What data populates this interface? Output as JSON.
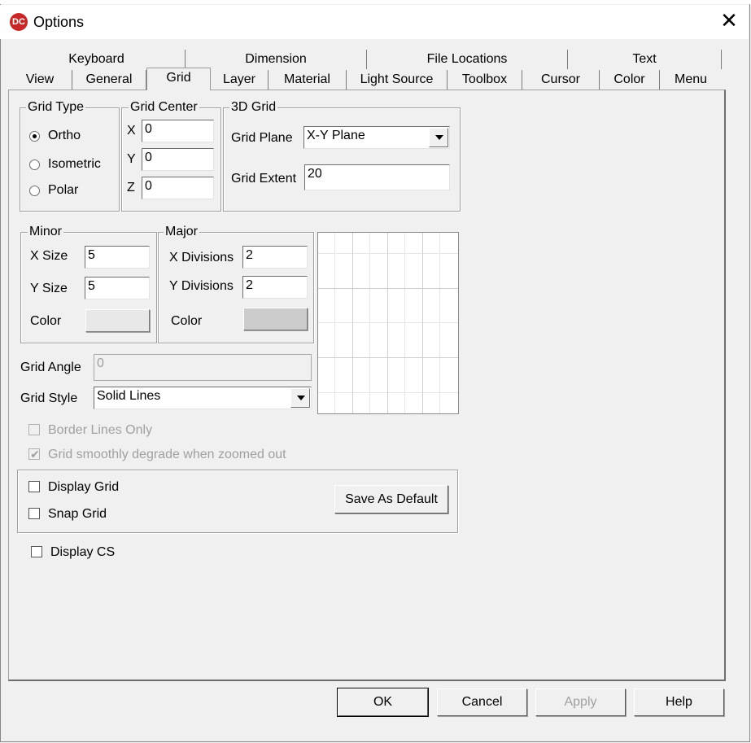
{
  "window": {
    "title": "Options",
    "app_icon": "DC"
  },
  "tabs_row1": [
    "Keyboard",
    "Dimension",
    "File Locations",
    "Text"
  ],
  "tabs_row2": [
    "View",
    "General",
    "Grid",
    "Layer",
    "Material",
    "Light Source",
    "Toolbox",
    "Cursor",
    "Color",
    "Menu"
  ],
  "selected_tab": "Grid",
  "grid_type": {
    "legend": "Grid Type",
    "options": [
      "Ortho",
      "Isometric",
      "Polar"
    ],
    "selected": "Ortho"
  },
  "grid_center": {
    "legend": "Grid Center",
    "x_label": "X",
    "x_value": "0",
    "y_label": "Y",
    "y_value": "0",
    "z_label": "Z",
    "z_value": "0"
  },
  "grid_3d": {
    "legend": "3D Grid",
    "plane_label": "Grid Plane",
    "plane_value": "X-Y Plane",
    "extent_label": "Grid Extent",
    "extent_value": "20"
  },
  "minor": {
    "legend": "Minor",
    "xsize_label": "X Size",
    "xsize_value": "5",
    "ysize_label": "Y Size",
    "ysize_value": "5",
    "color_label": "Color"
  },
  "major": {
    "legend": "Major",
    "xdiv_label": "X Divisions",
    "xdiv_value": "2",
    "ydiv_label": "Y Divisions",
    "ydiv_value": "2",
    "color_label": "Color"
  },
  "grid_angle": {
    "label": "Grid Angle",
    "value": "0"
  },
  "grid_style": {
    "label": "Grid Style",
    "value": "Solid Lines"
  },
  "options": {
    "border_lines_only": "Border Lines Only",
    "smooth_degrade": "Grid smoothly degrade when zoomed out",
    "display_grid": "Display Grid",
    "snap_grid": "Snap Grid",
    "save_default": "Save As Default",
    "display_cs": "Display CS"
  },
  "buttons": {
    "ok": "OK",
    "cancel": "Cancel",
    "apply": "Apply",
    "help": "Help"
  }
}
